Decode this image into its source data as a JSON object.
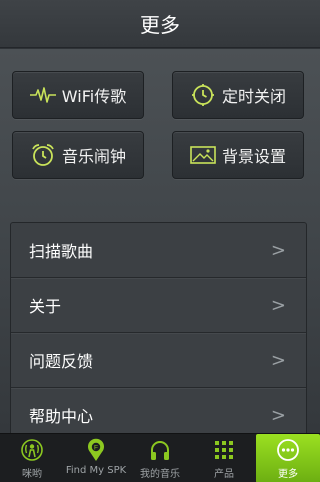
{
  "header": {
    "title": "更多"
  },
  "tiles": [
    {
      "label": "WiFi传歌",
      "icon": "waveform-icon"
    },
    {
      "label": "定时关闭",
      "icon": "timer-clock-icon"
    },
    {
      "label": "音乐闹钟",
      "icon": "alarm-clock-icon"
    },
    {
      "label": "背景设置",
      "icon": "picture-icon"
    }
  ],
  "menu": {
    "items": [
      {
        "label": "扫描歌曲",
        "chevron": ">"
      },
      {
        "label": "关于",
        "chevron": ">"
      },
      {
        "label": "问题反馈",
        "chevron": ">"
      },
      {
        "label": "帮助中心",
        "chevron": ">"
      }
    ]
  },
  "bottom_nav": {
    "tabs": [
      {
        "label": "咪哟",
        "icon": "broadcast-person-icon",
        "active": false
      },
      {
        "label": "Find My SPK",
        "icon": "location-pin-icon",
        "active": false
      },
      {
        "label": "我的音乐",
        "icon": "headphones-icon",
        "active": false
      },
      {
        "label": "产品",
        "icon": "grid-dots-icon",
        "active": false
      },
      {
        "label": "更多",
        "icon": "more-dots-icon",
        "active": true
      }
    ]
  },
  "colors": {
    "accent": "#9be021",
    "icon_accent": "#c9e35a",
    "background": "#2f3337"
  }
}
